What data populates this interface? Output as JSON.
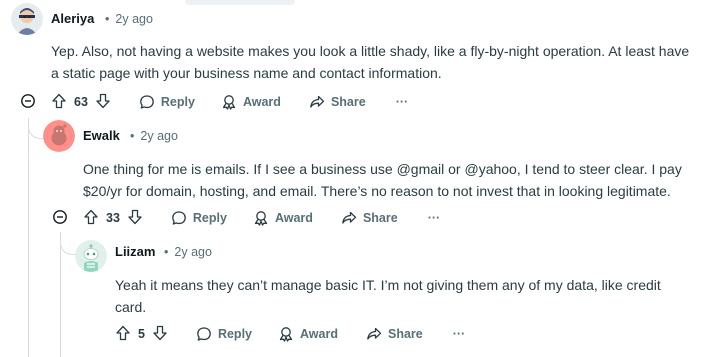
{
  "comments": [
    {
      "username": "Aleriya",
      "age": "2y ago",
      "body": "Yep. Also, not having a website makes you look a little shady, like a fly-by-night operation. At least have a static page with your business name and contact information.",
      "votes": "63",
      "reply_label": "Reply",
      "award_label": "Award",
      "share_label": "Share",
      "more_label": "···"
    },
    {
      "username": "Ewalk",
      "age": "2y ago",
      "body": "One thing for me is emails. If I see a business use @gmail or @yahoo, I tend to steer clear. I pay $20/yr for domain, hosting, and email. There’s no reason to not invest that in looking legitimate.",
      "votes": "33",
      "reply_label": "Reply",
      "award_label": "Award",
      "share_label": "Share",
      "more_label": "···"
    },
    {
      "username": "Liizam",
      "age": "2y ago",
      "body": "Yeah it means they can’t manage basic IT. I’m not giving them any of my data, like credit card.",
      "votes": "5",
      "reply_label": "Reply",
      "award_label": "Award",
      "share_label": "Share",
      "more_label": "···"
    }
  ],
  "separator": "•",
  "icons": {
    "upvote": "upvote-arrow-icon",
    "downvote": "downvote-arrow-icon",
    "reply": "speech-bubble-icon",
    "award": "award-ribbon-icon",
    "share": "share-arrow-icon",
    "collapse": "collapse-minus-icon"
  }
}
